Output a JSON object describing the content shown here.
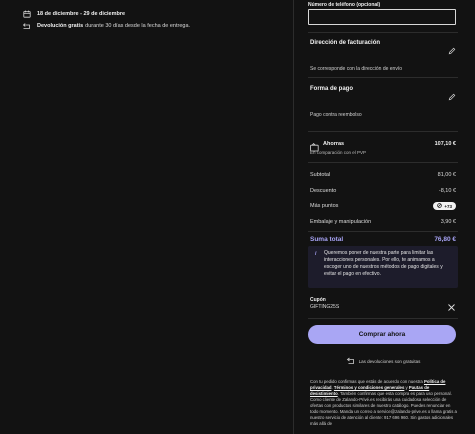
{
  "delivery": {
    "date_range": "18 de diciembre - 29 de diciembre",
    "free_return_bold": "Devolución gratis",
    "free_return_text": "durante 30 días desde la fecha de entrega."
  },
  "phone": {
    "label": "Número de teléfono (opcional)",
    "value": ""
  },
  "billing": {
    "title": "Dirección de facturación",
    "text": "Se corresponde con la dirección de envío"
  },
  "payment": {
    "title": "Forma de pago",
    "text": "Pago contra reembolso"
  },
  "savings": {
    "title": "Ahorras",
    "subtitle": "En comparación con el PVP",
    "value": "107,10 €"
  },
  "summary": {
    "subtotal_label": "Subtotal",
    "subtotal_value": "81,00 €",
    "discount_label": "Descuento",
    "discount_value": "-8,10 €",
    "points_label": "Más puntos",
    "points_value": "+73",
    "shipping_label": "Embalaje y manipulación",
    "shipping_value": "3,90 €",
    "total_label": "Suma total",
    "total_value": "76,80 €"
  },
  "notice": {
    "icon": "i",
    "text": "Queremos poner de nuestra parte para limitar las interacciones personales. Por ello, te animamos a escoger uno de nuestros métodos de pago digitales y evitar el pago en efectivo."
  },
  "coupon": {
    "label": "Cupón",
    "code": "GIFTING25S"
  },
  "buy_button": "Comprar ahora",
  "returns_text": "Las devoluciones son gratuitas",
  "legal": {
    "part1": "Con tu pedido confirmas que estás de acuerdo con nuestra",
    "link_privacy": "Política de privacidad",
    "link_terms": "Términos y condiciones generales",
    "and": "y",
    "link_withdrawal": "Pautas de desistimiento",
    "part2": "También confirmas que esta compra es para uso personal. Como cliente de Zalando-Privé.es recibirás una cuidadosa selección de ofertas con productos similares de nuestro catálogo. Puedes renunciar en todo momento. Manda un correo a service@zalando-prive.es o llama gratis a nuestro servicio de atención al cliente: 917 696 960. Sin gastos adicionales más allá de"
  },
  "colors": {
    "background": "#121212",
    "accent": "#a9a6f4",
    "total": "#a7a3f5",
    "notice_bg": "#1d1c2b"
  },
  "icons": [
    "calendar-icon",
    "return-icon",
    "pencil-icon",
    "tag-icon",
    "points-icon",
    "info-icon",
    "close-icon",
    "return-package-icon"
  ]
}
